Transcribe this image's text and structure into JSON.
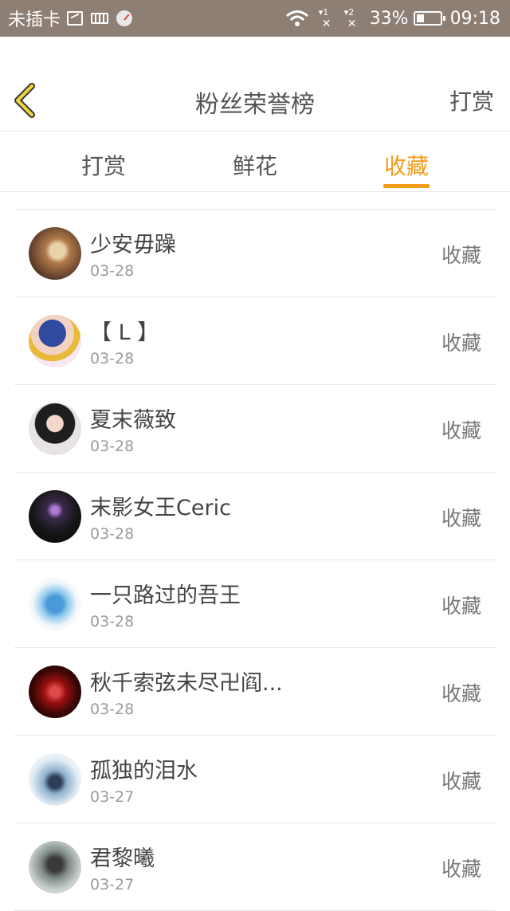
{
  "status_bar": {
    "carrier": "未插卡",
    "battery_percent": "33%",
    "battery_level": 0.33,
    "time": "09:18",
    "sim1": "1",
    "sim2": "2"
  },
  "header": {
    "title": "粉丝荣誉榜",
    "right_action": "打赏",
    "back_icon": "chevron-left-icon"
  },
  "tabs": [
    {
      "label": "打赏",
      "active": false
    },
    {
      "label": "鲜花",
      "active": false
    },
    {
      "label": "收藏",
      "active": true
    }
  ],
  "colors": {
    "accent": "#f39c1a",
    "status_bar": "#8e7f74",
    "back_icon": "#f2d53a"
  },
  "fans": [
    {
      "name": "少安毋躁",
      "date": "03-28",
      "tag": "收藏"
    },
    {
      "name": "【 L 】",
      "date": "03-28",
      "tag": "收藏"
    },
    {
      "name": "夏末薇致",
      "date": "03-28",
      "tag": "收藏"
    },
    {
      "name": "末影女王Ceric",
      "date": "03-28",
      "tag": "收藏"
    },
    {
      "name": "一只路过的吾王",
      "date": "03-28",
      "tag": "收藏"
    },
    {
      "name": "秋千索弦未尽卍阎...",
      "date": "03-28",
      "tag": "收藏"
    },
    {
      "name": "孤独的泪水",
      "date": "03-27",
      "tag": "收藏"
    },
    {
      "name": "君黎曦",
      "date": "03-27",
      "tag": "收藏"
    }
  ]
}
